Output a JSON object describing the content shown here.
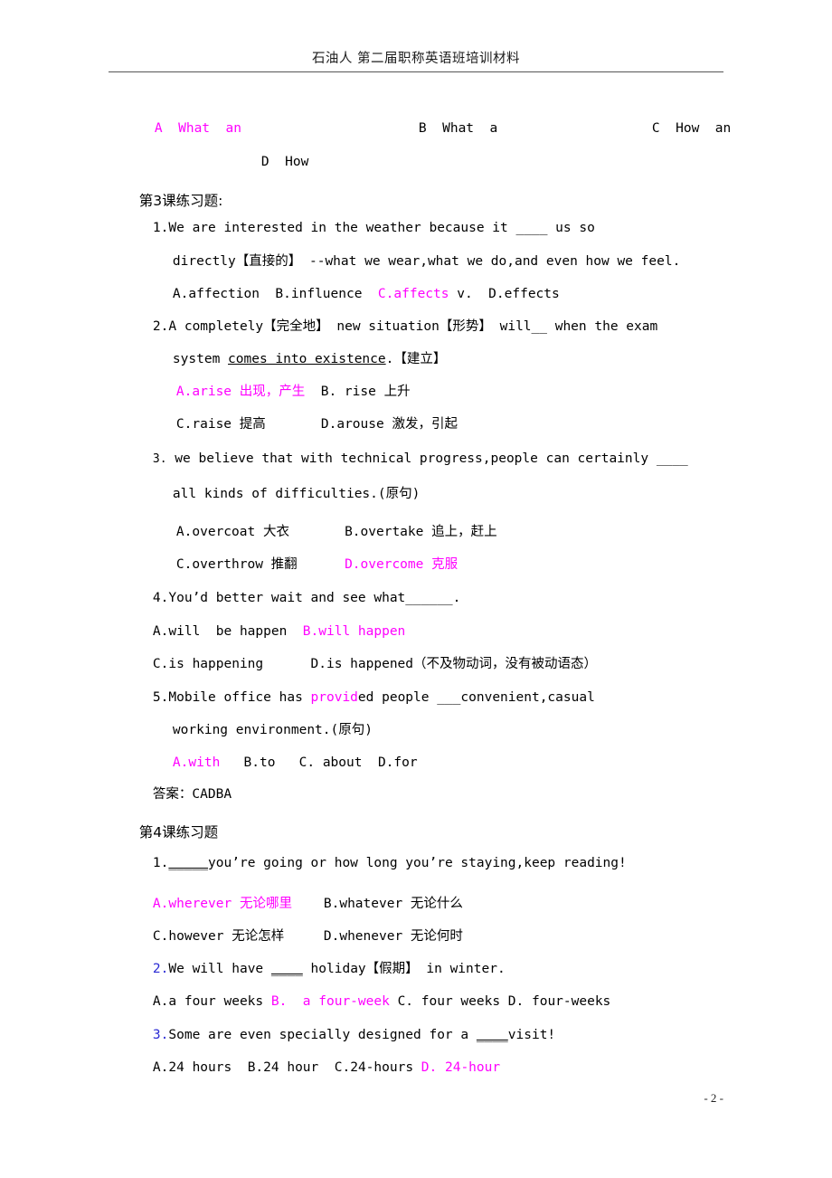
{
  "document": {
    "header": "石油人    第二届职称英语班培训材料",
    "page_number": "- 2 -"
  },
  "carryover_options": {
    "a": "A  What  an",
    "b": "B  What  a",
    "c": "C  How  an",
    "d": "D  How"
  },
  "lesson3": {
    "heading": "第3课练习题:",
    "questions": [
      {
        "number": "1.",
        "stem_line1": "We are interested in the weather because it ____ us so",
        "stem_line2_a": "directly",
        "stem_line2_cn": "【直接的】",
        "stem_line2_b": " --what we wear,what we do,and even how we feel.",
        "options_line": {
          "a": "A.affection",
          "b": "B.influence",
          "c": "C.affects",
          "c_suffix": "v.",
          "d": "D.effects"
        }
      },
      {
        "number": "2.",
        "stem_line1_a": "A completely",
        "stem_line1_cn1": "【完全地】",
        "stem_line1_b": " new situation",
        "stem_line1_cn2": "【形势】",
        "stem_line1_c": " will__ when the exam",
        "stem_line2_a": "system ",
        "stem_line2_underline": "comes into existence",
        "stem_line2_b": ".",
        "stem_line2_cn": "【建立】",
        "option_a": "A.arise 出现，产生",
        "option_b": "B. rise 上升",
        "option_c": "C.raise 提高",
        "option_d": "D.arouse 激发，引起"
      },
      {
        "number": "3.",
        "stem_line1": " we believe that with technical progress,people can certainly ____",
        "stem_line2": "all kinds of difficulties.(原句)",
        "option_a": "A.overcoat 大衣",
        "option_b": "B.overtake 追上，赶上",
        "option_c": "C.overthrow 推翻",
        "option_d": "D.overcome 克服"
      },
      {
        "number": "4.",
        "stem_line1": "You’d better wait and see what______.",
        "option_a": "A.will  be happen",
        "option_b": "B.will happen",
        "option_c": "C.is happening",
        "option_d": "D.is happened（不及物动词，没有被动语态）"
      },
      {
        "number": "5.",
        "stem_line1_a": "Mobile office has ",
        "stem_line1_magenta": "provid",
        "stem_line1_b": "ed people ___convenient,casual",
        "stem_line2": "working environment.(原句)",
        "option_a": "A.with",
        "option_b": "B.to",
        "option_c": "C. about",
        "option_d": "D.for"
      }
    ],
    "answer_label": "答案：CADBA"
  },
  "lesson4": {
    "heading": "第4课练习题",
    "questions": [
      {
        "number": "1.",
        "stem_blank": "_____",
        "stem": "you’re going or how long you’re staying,keep reading!",
        "option_a": "A.wherever 无论哪里",
        "option_b": "B.whatever 无论什么",
        "option_c": "C.however 无论怎样",
        "option_d": "D.whenever 无论何时"
      },
      {
        "number": "2.",
        "stem_a": "We will have ",
        "stem_blank": "____",
        "stem_b": " holiday",
        "stem_cn": "【假期】",
        "stem_c": " in winter.",
        "option_a": "A.a four weeks",
        "option_b": "B.  a four-week",
        "option_c": "C. four weeks",
        "option_d": "D. four-weeks"
      },
      {
        "number": "3.",
        "stem_a": "Some are even specially designed for a ",
        "stem_blank": "____",
        "stem_b": "visit!",
        "option_a": "A.24 hours",
        "option_b": "B.24 hour",
        "option_c": "C.24-hours",
        "option_d": "D. 24-hour"
      }
    ]
  }
}
